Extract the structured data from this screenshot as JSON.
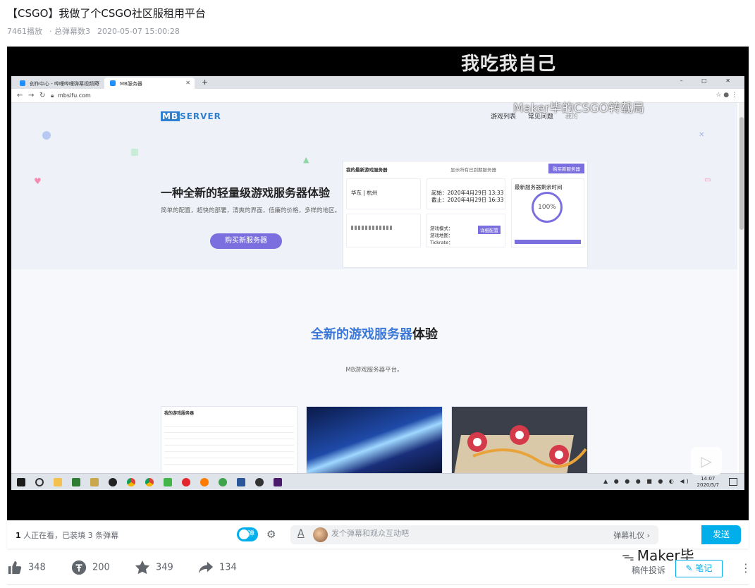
{
  "video": {
    "title": "【CSGO】我做了个CSGO社区服租用平台",
    "plays": "7461播放",
    "danmaku_total": "· 总弹幕数3",
    "date": "2020-05-07 15:00:28"
  },
  "overlay": {
    "caption": "我吃我自己",
    "watermark": "Maker毕的CSGO转载局"
  },
  "browser": {
    "tabs": [
      {
        "label": "创作中心 - 哔哩哔哩弹幕视频网"
      },
      {
        "label": "MB服务器"
      }
    ],
    "new_tab": "+",
    "window_controls": "–  □  ✕",
    "url": "mbsifu.com",
    "site": {
      "logo_mb": "MB",
      "logo_server": "SERVER",
      "nav": [
        "游戏列表",
        "常见问题",
        "我的"
      ],
      "hero_heading": "一种全新的轻量级游戏服务器体验",
      "hero_desc": "简单的配置，超快的部署，清爽的界面，低廉的价格，多样的地区。",
      "buy_button": "购买新服务器",
      "dashboard": {
        "title": "我的最新游戏服务器",
        "checkbox": "显示所有已到期服务器",
        "buy": "购买新服务器",
        "region": "华东 | 杭州",
        "start": "起始：2020年4月29日 13:33",
        "end": "截止：2020年4月29日 16:33",
        "remaining_title": "最新服务器剩余时间",
        "percent": "100%",
        "mode_label": "游戏模式：",
        "map_label": "游戏地图：",
        "tickrate_label": "Tickrate：",
        "detail_btn": "详细配置"
      },
      "section2_heading_blue": "全新的游戏服务器",
      "section2_heading_dark": "体验",
      "section2_sub": "MB游戏服务器平台。",
      "thumb1_title": "我的游戏服务器"
    },
    "clock_time": "14:07",
    "clock_date": "2020/5/7"
  },
  "player_controls": {
    "viewers_count": "1",
    "viewers_text": " 人正在看，已装填 3 条弹幕",
    "danmaku_toggle": "弹",
    "danmaku_font_icon": "A",
    "danmaku_placeholder": "发个弹幕和观众互动吧",
    "danmaku_etiquette": "弹幕礼仪 ›",
    "send": "发送"
  },
  "actions": {
    "like": "348",
    "coin": "200",
    "favorite": "349",
    "share": "134",
    "report": "稿件投诉",
    "note": "笔记",
    "watermark": "Maker毕"
  },
  "colors": {
    "accent": "#00aeec",
    "purple": "#7b6fe0"
  }
}
